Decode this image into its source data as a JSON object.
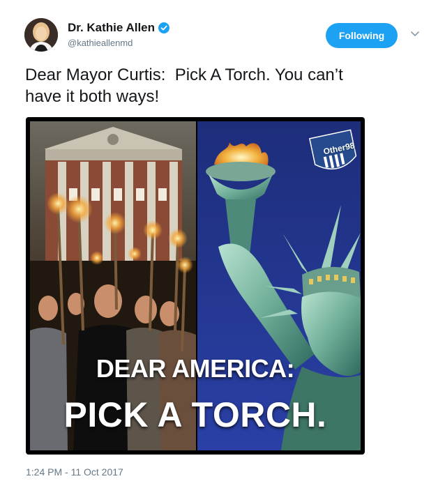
{
  "author": {
    "display_name": "Dr. Kathie Allen",
    "handle": "@kathieallenmd",
    "verified": true,
    "verified_icon": "verified-badge-icon"
  },
  "follow_button": {
    "label": "Following"
  },
  "tweet": {
    "text": "Dear Mayor Curtis:  Pick A Torch. You can’t\nhave it both ways!",
    "timestamp": "1:24 PM - 11 Oct 2017"
  },
  "media": {
    "caption_line1": "DEAR AMERICA:",
    "caption_line2": "PICK A TORCH.",
    "watermark": "Other98"
  },
  "colors": {
    "accent": "#1da1f2",
    "text_primary": "#14171a",
    "text_secondary": "#657786"
  },
  "icons": {
    "more_menu": "chevron-down-icon"
  }
}
